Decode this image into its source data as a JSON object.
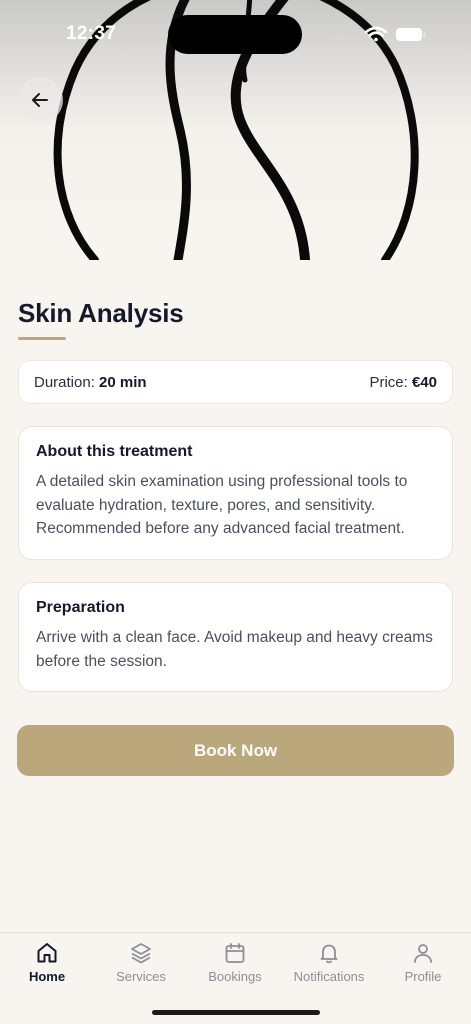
{
  "status_bar": {
    "time": "12:37"
  },
  "hero": {
    "image": "abstract-line-art"
  },
  "page": {
    "title": "Skin Analysis"
  },
  "info": {
    "duration_label": "Duration:",
    "duration_value": "20 min",
    "price_label": "Price:",
    "price_value": "€40"
  },
  "about": {
    "title": "About this treatment",
    "text": "A detailed skin examination using professional tools to evaluate hydration, texture, pores, and sensitivity. Recommended before any advanced facial treatment."
  },
  "preparation": {
    "title": "Preparation",
    "text": "Arrive with a clean face. Avoid makeup and heavy creams before the session."
  },
  "book_button": {
    "label": "Book Now"
  },
  "tabs": [
    {
      "label": "Home",
      "icon": "home-icon",
      "active": true
    },
    {
      "label": "Services",
      "icon": "layers-icon",
      "active": false
    },
    {
      "label": "Bookings",
      "icon": "calendar-icon",
      "active": false
    },
    {
      "label": "Notifications",
      "icon": "bell-icon",
      "active": false
    },
    {
      "label": "Profile",
      "icon": "user-icon",
      "active": false
    }
  ],
  "colors": {
    "accent": "#bba77c",
    "underline": "#bfa57a",
    "background": "#f8f5f0"
  }
}
